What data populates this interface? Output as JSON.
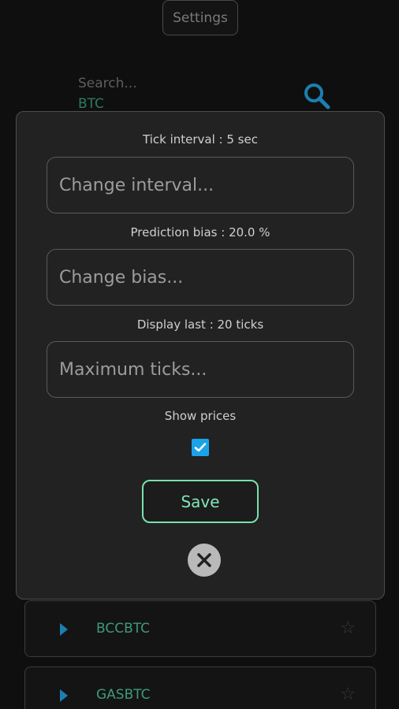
{
  "header": {
    "settings_label": "Settings"
  },
  "search": {
    "placeholder": "Search...",
    "value": "BTC",
    "icon": "search-icon"
  },
  "dialog": {
    "tick_interval_label": "Tick interval : 5 sec",
    "interval_placeholder": "Change interval...",
    "prediction_bias_label": "Prediction bias : 20.0 %",
    "bias_placeholder": "Change bias...",
    "display_last_label": "Display last : 20 ticks",
    "max_ticks_placeholder": "Maximum ticks...",
    "show_prices_label": "Show prices",
    "show_prices_checked": true,
    "save_label": "Save",
    "close_icon": "close-icon"
  },
  "list": {
    "items": [
      {
        "pair": "BCCBTC"
      },
      {
        "pair": "GASBTC"
      }
    ]
  },
  "colors": {
    "accent_green": "#78e2ae",
    "checkbox_blue": "#1aa3e8",
    "play_blue": "#1b7fb0",
    "pair_green": "#3f9a78"
  }
}
